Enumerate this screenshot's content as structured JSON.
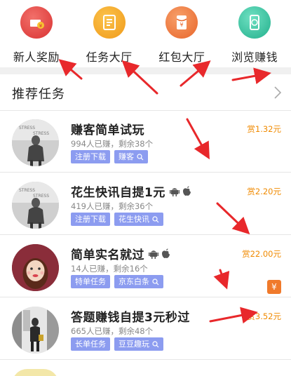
{
  "categories": [
    {
      "label": "新人奖励",
      "icon": "gift-money-icon",
      "color": "#e94b4b"
    },
    {
      "label": "任务大厅",
      "icon": "task-list-icon",
      "color": "#f5a623"
    },
    {
      "label": "红包大厅",
      "icon": "red-envelope-icon",
      "color": "#f07a3a"
    },
    {
      "label": "浏览赚钱",
      "icon": "coin-phone-icon",
      "color": "#3bc9a6"
    }
  ],
  "recommended": {
    "title": "推荐任务",
    "icon": "chevron-right-icon"
  },
  "tasks": [
    {
      "title": "赚客简单试玩",
      "meta": "994人已赚，剩余38个",
      "reward": "赏1.32元",
      "tags": [
        "注册下载",
        "赚客"
      ],
      "search_tag_index": 1,
      "platforms": []
    },
    {
      "title": "花生快讯自提1元",
      "meta": "419人已赚，剩余36个",
      "reward": "赏2.20元",
      "tags": [
        "注册下载",
        "花生快讯"
      ],
      "search_tag_index": 1,
      "platforms": [
        "android-icon",
        "apple-icon"
      ]
    },
    {
      "title": "简单实名就过",
      "meta": "14人已赚，剩余16个",
      "reward": "赏22.00元",
      "tags": [
        "特单任务",
        "京东白条"
      ],
      "search_tag_index": 1,
      "platforms": [
        "android-icon",
        "apple-icon"
      ],
      "badge": "¥"
    },
    {
      "title": "答题赚钱自提3元秒过",
      "meta": "665人已赚，剩余48个",
      "reward": "赏3.52元",
      "tags": [
        "长单任务",
        "豆豆趣玩"
      ],
      "search_tag_index": 1,
      "platforms": []
    }
  ],
  "colors": {
    "accent_tag": "#8c9cf0",
    "reward": "#f08a00",
    "annotation_arrow": "#e8282b"
  }
}
